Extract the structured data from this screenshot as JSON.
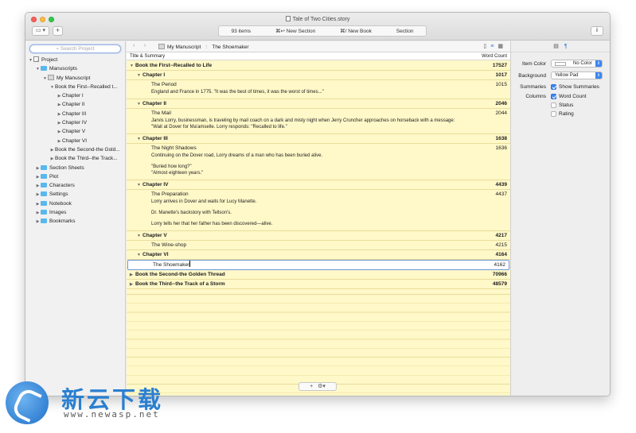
{
  "window": {
    "title": "Tale of Two Cities.story",
    "toolbar": {
      "view_label": "▭ ▾",
      "add_label": "+",
      "info_label": "i",
      "activity_items": [
        "93 items",
        "⌘↩ New Section",
        "⌘/ New Book",
        "Section"
      ]
    }
  },
  "sidebar": {
    "search_placeholder": "Search Project",
    "items": [
      {
        "label": "Project",
        "indent": 0,
        "arrow": "▼",
        "icon": "project-icon"
      },
      {
        "label": "Manuscripts",
        "indent": 1,
        "arrow": "▼",
        "icon": "folder-icon"
      },
      {
        "label": "My Manuscript",
        "indent": 2,
        "arrow": "▼",
        "icon": "manuscript-icon"
      },
      {
        "label": "Book the First--Recalled t...",
        "indent": 3,
        "arrow": "▼",
        "icon": ""
      },
      {
        "label": "Chapter I",
        "indent": 4,
        "arrow": "▶",
        "icon": ""
      },
      {
        "label": "Chapter II",
        "indent": 4,
        "arrow": "▶",
        "icon": ""
      },
      {
        "label": "Chapter III",
        "indent": 4,
        "arrow": "▶",
        "icon": ""
      },
      {
        "label": "Chapter IV",
        "indent": 4,
        "arrow": "▶",
        "icon": ""
      },
      {
        "label": "Chapter V",
        "indent": 4,
        "arrow": "▶",
        "icon": ""
      },
      {
        "label": "Chapter VI",
        "indent": 4,
        "arrow": "▶",
        "icon": ""
      },
      {
        "label": "Book the Second-the Gold...",
        "indent": 3,
        "arrow": "▶",
        "icon": ""
      },
      {
        "label": "Book the Third--the Track...",
        "indent": 3,
        "arrow": "▶",
        "icon": ""
      },
      {
        "label": "Section Sheets",
        "indent": 1,
        "arrow": "▶",
        "icon": "folder-icon"
      },
      {
        "label": "Plot",
        "indent": 1,
        "arrow": "▶",
        "icon": "folder-icon"
      },
      {
        "label": "Characters",
        "indent": 1,
        "arrow": "▶",
        "icon": "folder-icon"
      },
      {
        "label": "Settings",
        "indent": 1,
        "arrow": "▶",
        "icon": "folder-icon"
      },
      {
        "label": "Notebook",
        "indent": 1,
        "arrow": "▶",
        "icon": "folder-icon"
      },
      {
        "label": "Images",
        "indent": 1,
        "arrow": "▶",
        "icon": "folder-icon"
      },
      {
        "label": "Bookmarks",
        "indent": 1,
        "arrow": "▶",
        "icon": "folder-icon"
      }
    ]
  },
  "outliner": {
    "breadcrumb": [
      "My Manuscript",
      "The Shoemaker"
    ],
    "column_title": "Title & Summary",
    "column_count": "Word Count",
    "add_label": "+",
    "gear_label": "⚙▾",
    "rows": [
      {
        "level": 0,
        "arrow": "▼",
        "title": "Book the First--Recalled to Life",
        "count": "17527",
        "bold": true,
        "summary": []
      },
      {
        "level": 1,
        "arrow": "▼",
        "title": "Chapter I",
        "count": "1017",
        "bold": true,
        "summary": []
      },
      {
        "level": 2,
        "arrow": "",
        "title": "The Period",
        "count": "1015",
        "bold": false,
        "summary": [
          "England and France in 1775. \"It was the best of times, it was the worst of times...\""
        ]
      },
      {
        "level": 1,
        "arrow": "▼",
        "title": "Chapter II",
        "count": "2046",
        "bold": true,
        "summary": []
      },
      {
        "level": 2,
        "arrow": "",
        "title": "The Mail",
        "count": "2044",
        "bold": false,
        "summary": [
          "Jarvis Lorry, businessman, is traveling by mail coach on a dark and misty night when Jerry Cruncher approaches on horseback with a message:",
          "\"Wait at Dover for Ma'amselle. Lorry responds: \"Recalled to life.\""
        ]
      },
      {
        "level": 1,
        "arrow": "▼",
        "title": "Chapter III",
        "count": "1638",
        "bold": true,
        "summary": []
      },
      {
        "level": 2,
        "arrow": "",
        "title": "The Night Shadows",
        "count": "1636",
        "bold": false,
        "summary": [
          "Continuing on the Dover road, Lorry dreams of a man who has been buried alive.",
          "",
          "\"Buried how long?\"",
          "\"Almost eighteen years.\""
        ]
      },
      {
        "level": 1,
        "arrow": "▼",
        "title": "Chapter IV",
        "count": "4439",
        "bold": true,
        "summary": []
      },
      {
        "level": 2,
        "arrow": "",
        "title": "The Preparation",
        "count": "4437",
        "bold": false,
        "summary": [
          "Lorry arrives in Dover and waits for Lucy Manette.",
          "",
          "Dr. Manette's backstory with Tellson's.",
          "",
          "Lorry tells her that her father has been discovered—alive."
        ]
      },
      {
        "level": 1,
        "arrow": "▼",
        "title": "Chapter V",
        "count": "4217",
        "bold": true,
        "summary": []
      },
      {
        "level": 2,
        "arrow": "",
        "title": "The Wine-shop",
        "count": "4215",
        "bold": false,
        "summary": []
      },
      {
        "level": 1,
        "arrow": "▼",
        "title": "Chapter VI",
        "count": "4164",
        "bold": true,
        "summary": []
      },
      {
        "level": 2,
        "arrow": "",
        "title": "The Shoemaker",
        "count": "4162",
        "bold": false,
        "summary": [],
        "selected": true
      },
      {
        "level": 0,
        "arrow": "▶",
        "title": "Book the Second-the Golden Thread",
        "count": "70966",
        "bold": true,
        "summary": []
      },
      {
        "level": 0,
        "arrow": "▶",
        "title": "Book the Third--the Track of a Storm",
        "count": "48579",
        "bold": true,
        "summary": []
      }
    ]
  },
  "inspector": {
    "item_color_label": "Item Color",
    "item_color_value": "No Color",
    "background_label": "Background",
    "background_value": "Yellow Pad",
    "summaries_label": "Summaries",
    "show_summaries_label": "Show Summaries",
    "columns_label": "Columns",
    "columns": [
      {
        "label": "Word Count",
        "checked": true
      },
      {
        "label": "Status",
        "checked": false
      },
      {
        "label": "Rating",
        "checked": false
      }
    ]
  },
  "watermark": {
    "name_cn": "新云下载",
    "url": "www.newasp.net"
  },
  "colors": {
    "outliner_background": "#fff8c8",
    "accent": "#3b87f1",
    "selection_border": "#6e96d8"
  }
}
